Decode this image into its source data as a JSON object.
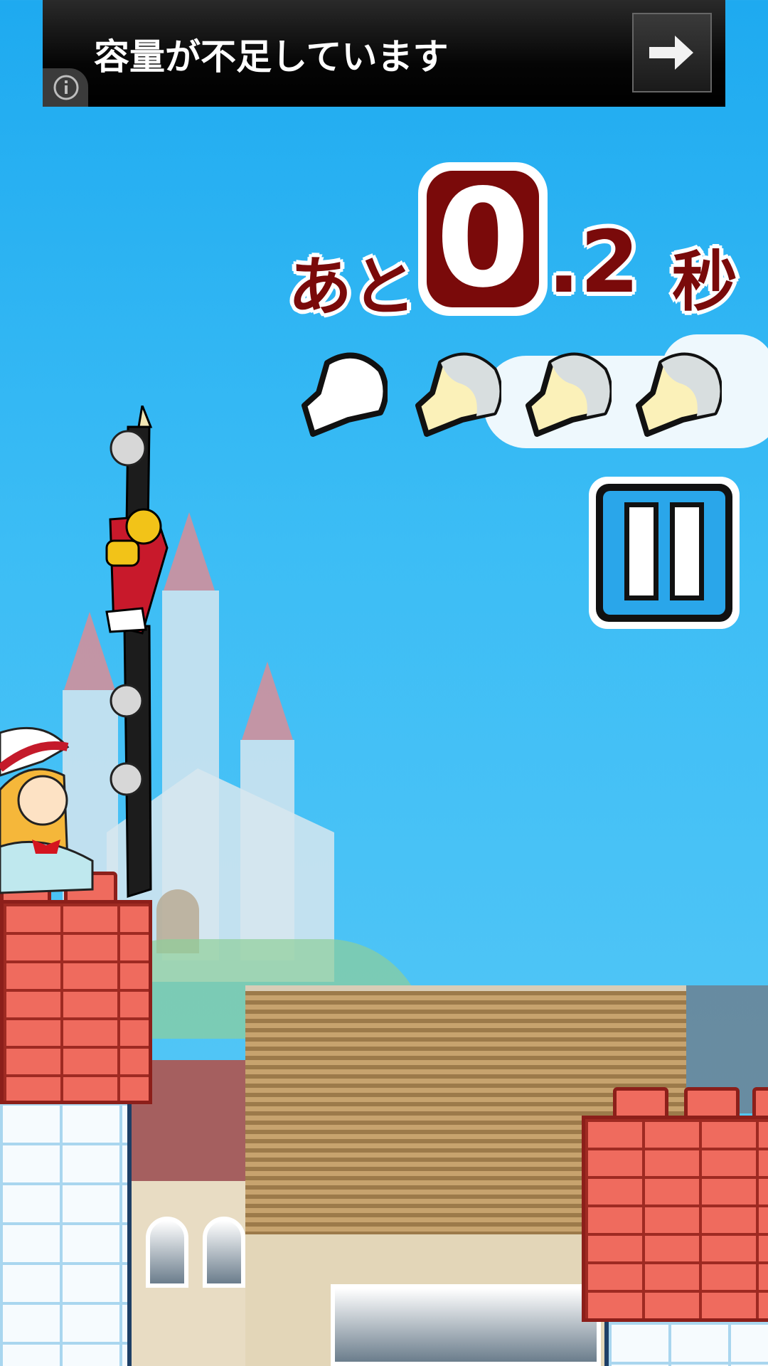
{
  "ad": {
    "text": "容量が不足しています",
    "arrow_icon": "arrow-right-icon",
    "info_icon": "info-icon"
  },
  "hud": {
    "timer_prefix": "あと",
    "timer_whole": "0",
    "timer_fraction": ".2",
    "timer_suffix": "秒",
    "timer_seconds": 0.2,
    "heads_total": 4,
    "heads_filled": 3,
    "pause_icon": "pause-icon"
  },
  "colors": {
    "sky": "#3cbdf5",
    "timer_text": "#7a0a0a",
    "pause_blue": "#2aa6ea",
    "brick": "#ef6b5e"
  }
}
